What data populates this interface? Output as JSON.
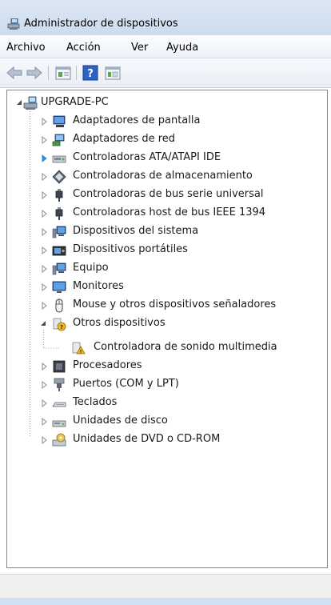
{
  "window": {
    "title": "Administrador de dispositivos"
  },
  "menu": {
    "items": [
      "Archivo",
      "Acción",
      "Ver",
      "Ayuda"
    ]
  },
  "toolbar": {
    "buttons": [
      "back-arrow-icon",
      "forward-arrow-icon",
      "properties-icon",
      "help-icon",
      "view-icon"
    ]
  },
  "tree": {
    "root": "UPGRADE-PC",
    "categories": [
      "Adaptadores de pantalla",
      "Adaptadores de red",
      "Controladoras ATA/ATAPI IDE",
      "Controladoras de almacenamiento",
      "Controladoras de bus serie universal",
      "Controladoras host de bus IEEE 1394",
      "Dispositivos del sistema",
      "Dispositivos portátiles",
      "Equipo",
      "Monitores",
      "Mouse y otros dispositivos señaladores",
      "Otros dispositivos",
      "Procesadores",
      "Puertos (COM y LPT)",
      "Teclados",
      "Unidades de disco",
      "Unidades de DVD o CD-ROM"
    ],
    "other_devices_children": [
      "Controladora de sonido multimedia"
    ]
  },
  "status": {
    "text": ""
  },
  "colors": {
    "title_bar": "#dbe6f4",
    "panel_border": "#828790",
    "hover_arrow": "#2c8fd6"
  }
}
